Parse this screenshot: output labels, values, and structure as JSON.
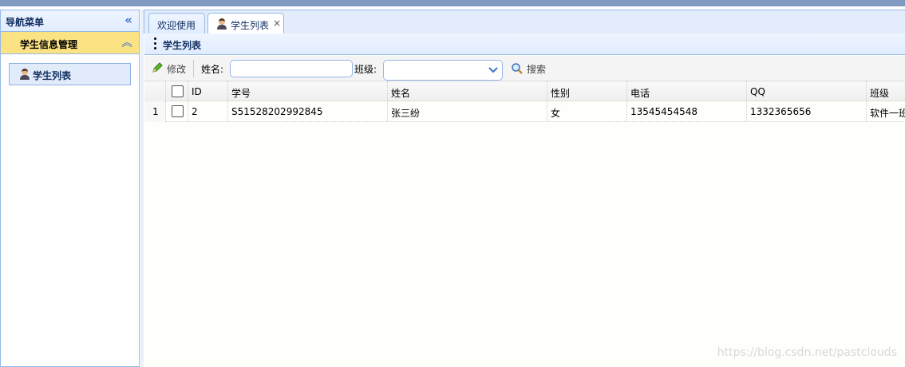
{
  "sidebar": {
    "title": "导航菜单",
    "collapse_icon": "double-chevron-left-icon",
    "section": {
      "title": "学生信息管理",
      "toggle_icon": "double-chevron-up-icon",
      "items": [
        {
          "label": "学生列表",
          "icon": "user-icon"
        }
      ]
    }
  },
  "tabs": [
    {
      "label": "欢迎使用",
      "active": false
    },
    {
      "label": "学生列表",
      "active": true,
      "icon": "user-icon",
      "close": "×"
    }
  ],
  "panel": {
    "title": "学生列表"
  },
  "toolbar": {
    "edit_label": "修改",
    "edit_icon": "pencil-icon",
    "name_label": "姓名:",
    "name_value": "",
    "class_label": "班级:",
    "class_value": "",
    "search_label": "搜索",
    "search_icon": "magnifier-icon"
  },
  "grid": {
    "columns": [
      "ID",
      "学号",
      "姓名",
      "性别",
      "电话",
      "QQ",
      "班级"
    ],
    "rows": [
      {
        "rownum": "1",
        "checked": false,
        "cells": [
          "2",
          "S51528202992845",
          "张三纷",
          "女",
          "13545454548",
          "1332365656",
          "软件一班"
        ]
      }
    ]
  },
  "watermark": "https://blog.csdn.net/pastclouds",
  "colors": {
    "border": "#95b8e7",
    "selected_section": "#fbe383",
    "top_bar": "#7f99c1"
  }
}
